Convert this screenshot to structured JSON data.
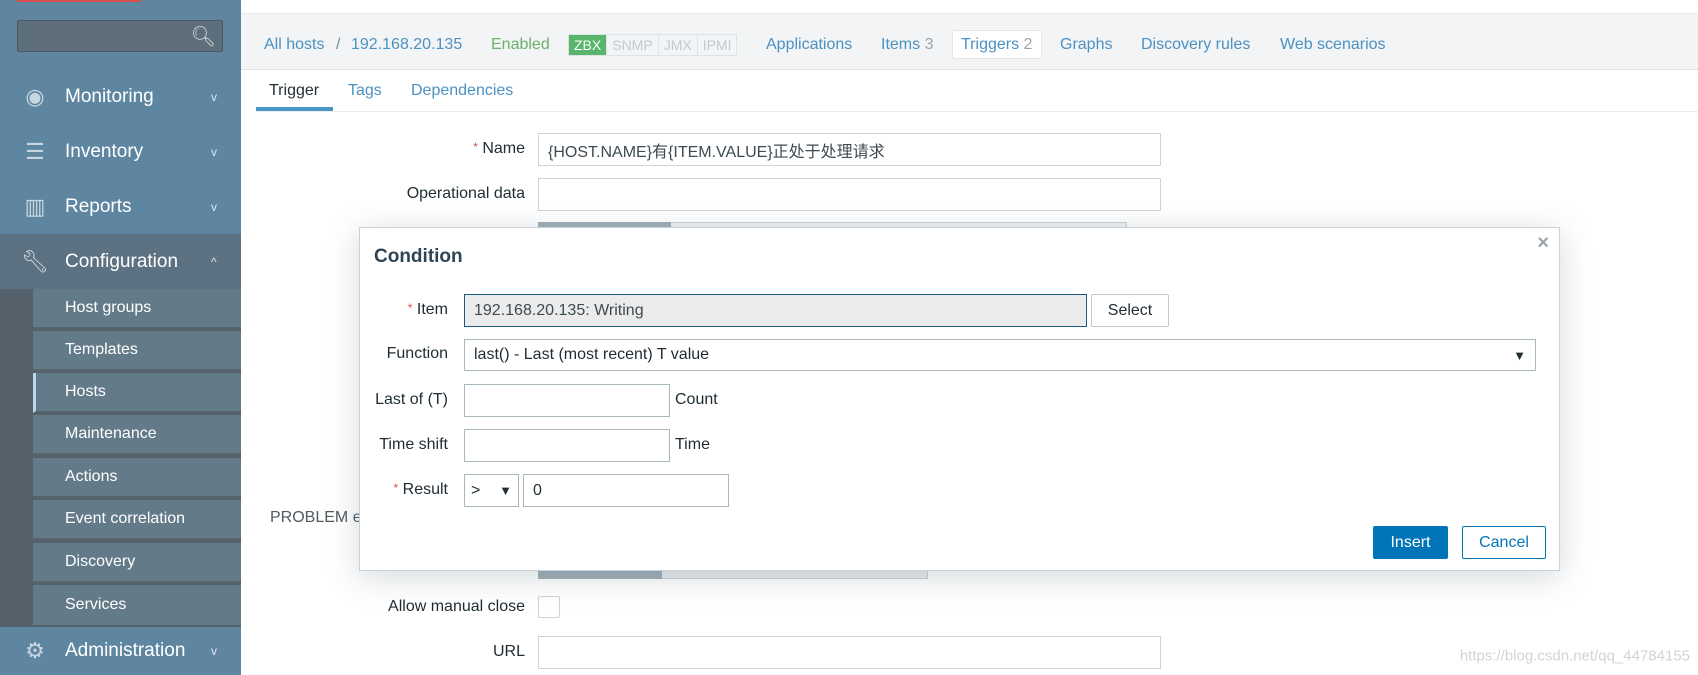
{
  "sidebar": {
    "search_placeholder": "",
    "menu": [
      {
        "label": "Monitoring",
        "icon": "eye-icon"
      },
      {
        "label": "Inventory",
        "icon": "list-icon"
      },
      {
        "label": "Reports",
        "icon": "bar-chart-icon"
      },
      {
        "label": "Configuration",
        "icon": "wrench-icon"
      },
      {
        "label": "Administration",
        "icon": "gear-icon"
      }
    ],
    "submenu": [
      "Host groups",
      "Templates",
      "Hosts",
      "Maintenance",
      "Actions",
      "Event correlation",
      "Discovery",
      "Services"
    ],
    "active_submenu": "Hosts"
  },
  "header": {
    "all_hosts": "All hosts",
    "sep": "/",
    "host": "192.168.20.135",
    "status": "Enabled",
    "protocols": [
      "ZBX",
      "SNMP",
      "JMX",
      "IPMI"
    ],
    "links": {
      "applications": "Applications",
      "items": "Items",
      "items_count": "3",
      "triggers": "Triggers",
      "triggers_count": "2",
      "graphs": "Graphs",
      "discovery": "Discovery rules",
      "web": "Web scenarios"
    }
  },
  "tabs": [
    "Trigger",
    "Tags",
    "Dependencies"
  ],
  "form": {
    "name_label": "Name",
    "name_value": "{HOST.NAME}有{ITEM.VALUE}正处于处理请求",
    "opdata_label": "Operational data",
    "opdata_value": "",
    "problem_label": "PROBLEM e",
    "manual_close_label": "Allow manual close",
    "url_label": "URL",
    "url_value": ""
  },
  "dialog": {
    "title": "Condition",
    "item_label": "Item",
    "item_value": "192.168.20.135: Writing",
    "select_label": "Select",
    "function_label": "Function",
    "function_value": "last() - Last (most recent) T value",
    "lastof_label": "Last of (T)",
    "lastof_value": "",
    "lastof_unit": "Count",
    "timeshift_label": "Time shift",
    "timeshift_value": "",
    "timeshift_unit": "Time",
    "result_label": "Result",
    "result_op": ">",
    "result_value": "0",
    "insert_label": "Insert",
    "cancel_label": "Cancel",
    "close": "×"
  },
  "watermark": "https://blog.csdn.net/qq_44784155",
  "colors": {
    "sidebar": "#5f86a0",
    "link": "#4b91c2",
    "primary": "#0275b8",
    "enabled": "#6ab26a",
    "zbx": "#59b56c"
  }
}
